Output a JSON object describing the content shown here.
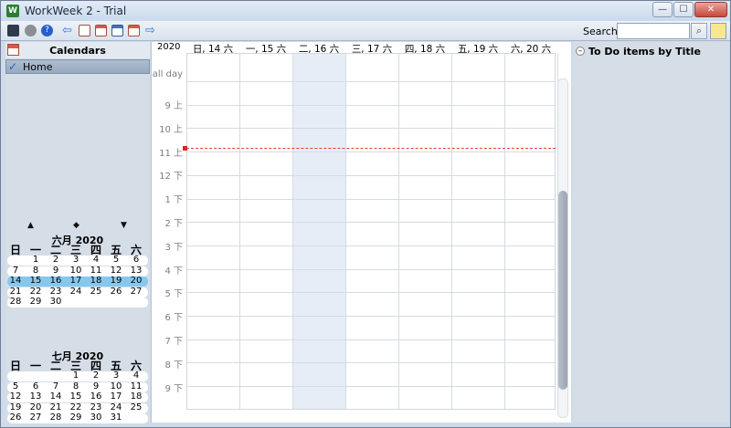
{
  "window": {
    "title": "WorkWeek 2 - Trial",
    "app_icon": "W",
    "min": "—",
    "max": "☐",
    "close": "✕"
  },
  "toolbar": {
    "icons": [
      "monitor-icon",
      "gear-icon",
      "help-icon",
      "back-arrow-icon",
      "day-view-icon",
      "week-view-icon",
      "month-view-icon",
      "year-view-icon",
      "forward-arrow-icon"
    ],
    "search_label": "Search",
    "search_value": "",
    "search_icon": "⌕"
  },
  "calendars": {
    "title": "Calendars",
    "items": [
      {
        "name": "Home",
        "checked": "✓"
      }
    ]
  },
  "mini_calendar": {
    "nav": {
      "prev": "▲",
      "today": "◆",
      "next": "▼"
    },
    "dow": [
      "日",
      "一",
      "二",
      "三",
      "四",
      "五",
      "六"
    ],
    "months": [
      {
        "title": "六月 2020",
        "weeks": [
          [
            "",
            "1",
            "2",
            "3",
            "4",
            "5",
            "6"
          ],
          [
            "7",
            "8",
            "9",
            "10",
            "11",
            "12",
            "13"
          ],
          [
            "14",
            "15",
            "16",
            "17",
            "18",
            "19",
            "20"
          ],
          [
            "21",
            "22",
            "23",
            "24",
            "25",
            "26",
            "27"
          ],
          [
            "28",
            "29",
            "30",
            "",
            "",
            "",
            ""
          ]
        ],
        "selected_week": 2
      },
      {
        "title": "七月 2020",
        "weeks": [
          [
            "",
            "",
            "",
            "1",
            "2",
            "3",
            "4"
          ],
          [
            "5",
            "6",
            "7",
            "8",
            "9",
            "10",
            "11"
          ],
          [
            "12",
            "13",
            "14",
            "15",
            "16",
            "17",
            "18"
          ],
          [
            "19",
            "20",
            "21",
            "22",
            "23",
            "24",
            "25"
          ],
          [
            "26",
            "27",
            "28",
            "29",
            "30",
            "31",
            ""
          ]
        ],
        "selected_week": -1
      }
    ]
  },
  "week_view": {
    "year": "2020",
    "days": [
      "日, 14 六",
      "一, 15 六",
      "二, 16 六",
      "三, 17 六",
      "四, 18 六",
      "五, 19 六",
      "六, 20 六"
    ],
    "today_index": 2,
    "all_day_label": "all day",
    "hours": [
      "9 上",
      "10 上",
      "11 上",
      "12 下",
      "1 下",
      "2 下",
      "3 下",
      "4 下",
      "5 下",
      "6 下",
      "7 下",
      "8 下",
      "9 下"
    ]
  },
  "todo": {
    "icon": "–",
    "title": "To Do items  by Title"
  },
  "colors": {
    "accent": "#86c7ee",
    "now_line": "#e0403a",
    "today_column": "#e6edf7"
  }
}
